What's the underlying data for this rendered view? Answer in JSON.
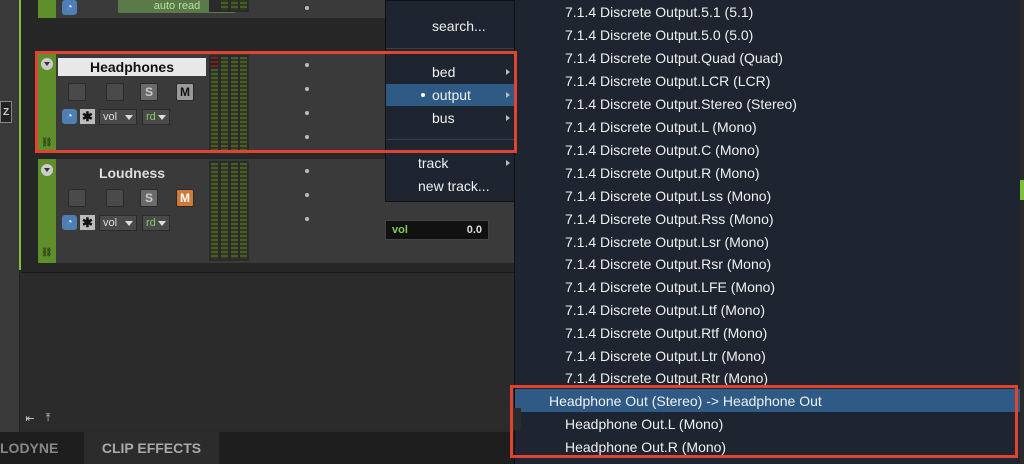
{
  "tracks": [
    {
      "name": "Headphones",
      "solo": "S",
      "mute": "M",
      "vol_label": "vol",
      "automation": "rd"
    },
    {
      "name": "Loudness",
      "solo": "S",
      "mute": "M",
      "vol_label": "vol",
      "automation": "rd"
    }
  ],
  "top_track": {
    "automation_mode": "auto read"
  },
  "vol_display": {
    "label": "vol",
    "value": "0.0"
  },
  "submenu": {
    "search": "search...",
    "bed": "bed",
    "output": "output",
    "bus": "bus",
    "track": "track",
    "new_track": "new track..."
  },
  "outputs": [
    "7.1.4 Discrete Output.5.1 (5.1)",
    "7.1.4 Discrete Output.5.0 (5.0)",
    "7.1.4 Discrete Output.Quad (Quad)",
    "7.1.4 Discrete Output.LCR (LCR)",
    "7.1.4 Discrete Output.Stereo (Stereo)",
    "7.1.4 Discrete Output.L (Mono)",
    "7.1.4 Discrete Output.C (Mono)",
    "7.1.4 Discrete Output.R (Mono)",
    "7.1.4 Discrete Output.Lss (Mono)",
    "7.1.4 Discrete Output.Rss (Mono)",
    "7.1.4 Discrete Output.Lsr (Mono)",
    "7.1.4 Discrete Output.Rsr (Mono)",
    "7.1.4 Discrete Output.LFE (Mono)",
    "7.1.4 Discrete Output.Ltf (Mono)",
    "7.1.4 Discrete Output.Rtf (Mono)",
    "7.1.4 Discrete Output.Ltr (Mono)",
    "7.1.4 Discrete Output.Rtr (Mono)"
  ],
  "headphone_outputs": {
    "selected": "Headphone Out (Stereo) -> Headphone Out",
    "left": "Headphone Out.L (Mono)",
    "right": "Headphone Out.R (Mono)"
  },
  "tabs": {
    "melodyne": "LODYNE",
    "clip_effects": "CLIP EFFECTS"
  },
  "left_button": "Z",
  "colors": {
    "highlight": "#e0432f",
    "menu_bg": "#1e2530",
    "selection": "#2e5a85",
    "track_green": "#5f8f2a"
  }
}
